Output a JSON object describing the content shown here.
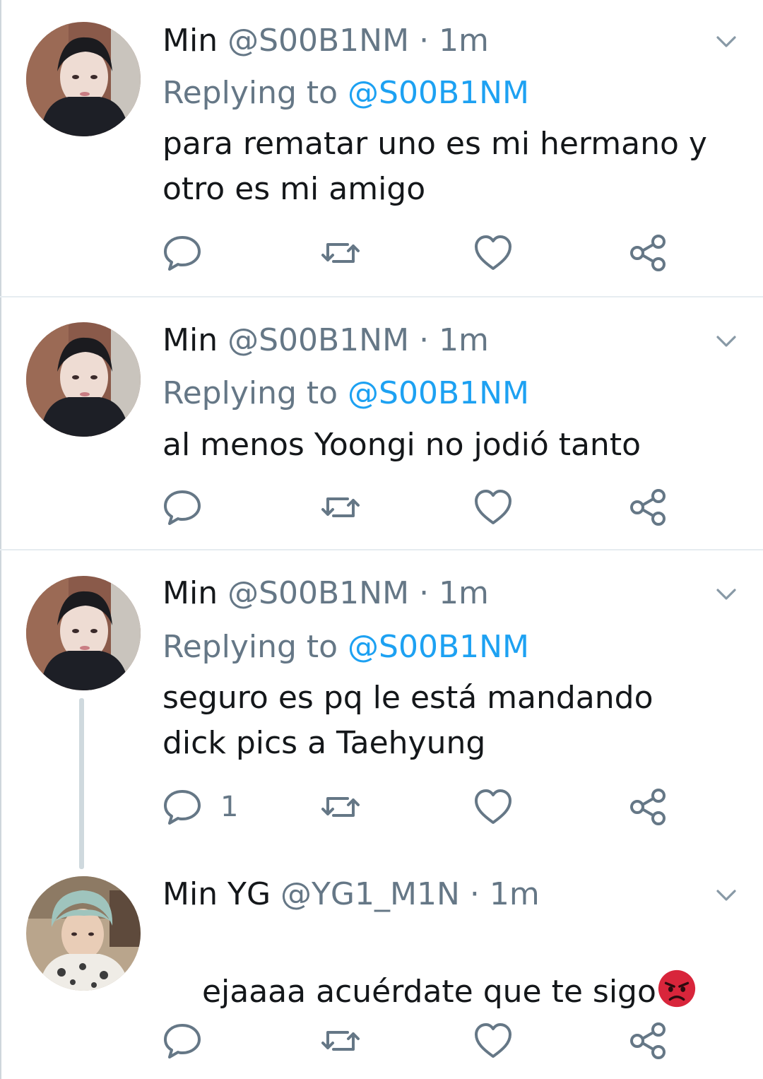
{
  "tweets": [
    {
      "name": "Min",
      "handle": "@S00B1NM",
      "dot": "·",
      "time": "1m",
      "replying_prefix": "Replying to ",
      "replying_handle": "@S00B1NM",
      "text": "para rematar uno es mi hermano y\notro es mi amigo",
      "reply_count": ""
    },
    {
      "name": "Min",
      "handle": "@S00B1NM",
      "dot": "·",
      "time": "1m",
      "replying_prefix": "Replying to ",
      "replying_handle": "@S00B1NM",
      "text": "al menos Yoongi no jodió tanto",
      "reply_count": ""
    },
    {
      "name": "Min",
      "handle": "@S00B1NM",
      "dot": "·",
      "time": "1m",
      "replying_prefix": "Replying to ",
      "replying_handle": "@S00B1NM",
      "text": "seguro es pq le está mandando\ndick pics a Taehyung",
      "reply_count": "1"
    },
    {
      "name": "Min YG",
      "handle": "@YG1_M1N",
      "dot": "·",
      "time": "1m",
      "text": "ejaaaa acuérdate que te sigo",
      "emoji": "angry-face-emoji",
      "reply_count": ""
    }
  ],
  "icons": {
    "reply": "reply-icon",
    "retweet": "retweet-icon",
    "like": "heart-icon",
    "share": "share-icon",
    "menu": "chevron-down-icon"
  },
  "colors": {
    "text": "#14171a",
    "secondary": "#657786",
    "mention": "#1da1f2",
    "icon": "#657786",
    "divider": "#e6ecf0"
  }
}
